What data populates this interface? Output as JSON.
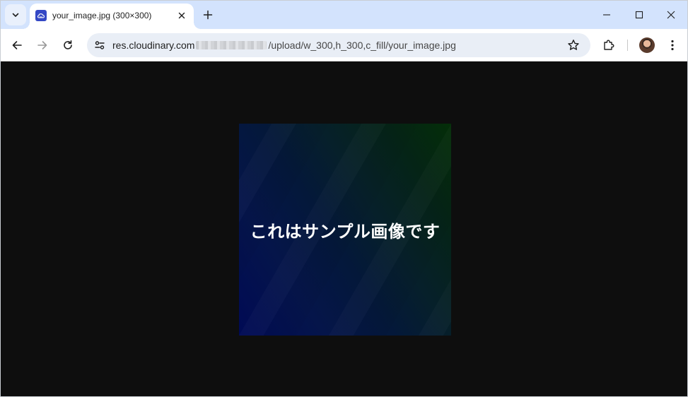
{
  "tab": {
    "title": "your_image.jpg (300×300)"
  },
  "omnibox": {
    "host": "res.cloudinary.com",
    "path": "/upload/w_300,h_300,c_fill/your_image.jpg"
  },
  "image": {
    "caption": "これはサンプル画像です"
  },
  "icons": {
    "tab_search": "chevron-down-icon",
    "favicon": "cloudinary-logo-icon",
    "tab_close": "close-icon",
    "new_tab": "plus-icon",
    "minimize": "minimize-icon",
    "maximize": "maximize-icon",
    "close_window": "close-icon",
    "back": "arrow-left-icon",
    "forward": "arrow-right-icon",
    "reload": "reload-icon",
    "site_info": "tune-icon",
    "bookmark": "star-icon",
    "extensions": "puzzle-icon",
    "profile": "avatar",
    "menu": "kebab-menu-icon"
  },
  "colors": {
    "tabstrip": "#d3e3fd",
    "content_bg": "#0e0e0e",
    "favicon": "#3448c5"
  }
}
